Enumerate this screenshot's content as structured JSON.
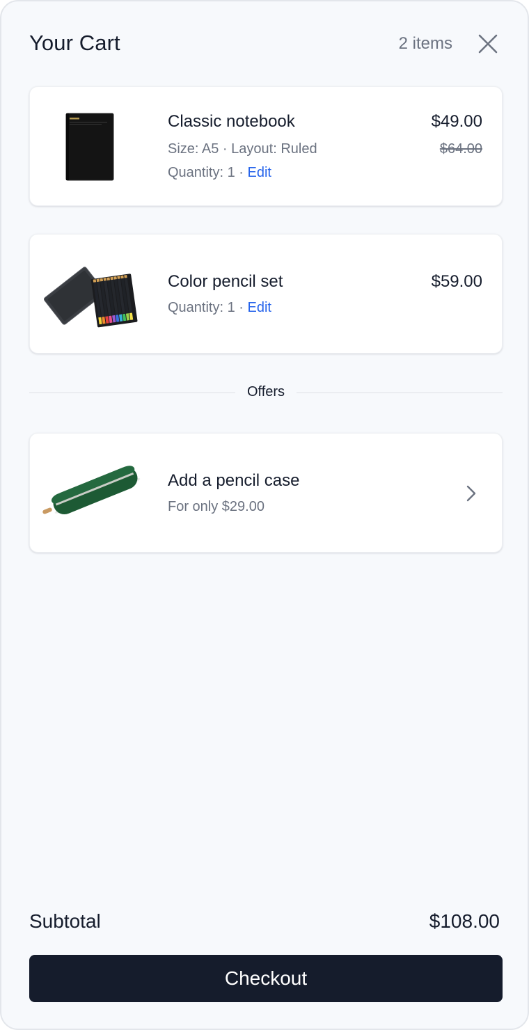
{
  "header": {
    "title": "Your Cart",
    "item_count": "2 items",
    "close_icon": "close-icon"
  },
  "cart": {
    "items": [
      {
        "name": "Classic notebook",
        "options": "Size: A5 · Layout: Ruled",
        "quantity_label": "Quantity: 1 · ",
        "edit_label": "Edit",
        "price": "$49.00",
        "original_price": "$64.00",
        "image": "black-notebook-image"
      },
      {
        "name": "Color pencil set",
        "quantity_label": "Quantity: 1 · ",
        "edit_label": "Edit",
        "price": "$59.00",
        "image": "pencil-set-image"
      }
    ]
  },
  "offers": {
    "section_label": "Offers",
    "items": [
      {
        "name": "Add a pencil case",
        "subtitle": "For only $29.00",
        "image": "green-pencil-case-image",
        "icon": "chevron-right-icon"
      }
    ]
  },
  "summary": {
    "subtotal_label": "Subtotal",
    "subtotal_value": "$108.00",
    "checkout_label": "Checkout"
  },
  "colors": {
    "background": "#f7f9fc",
    "card": "#ffffff",
    "text_primary": "#151c2c",
    "text_secondary": "#6b7280",
    "link": "#2563eb",
    "button": "#151c2c"
  }
}
